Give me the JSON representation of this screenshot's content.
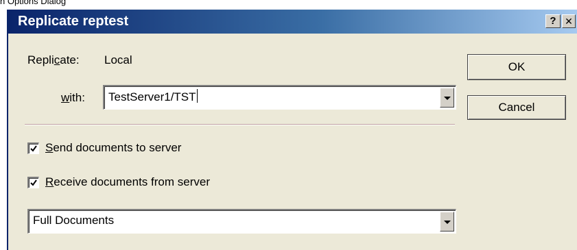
{
  "caption": "n Options Dialog",
  "dialog": {
    "title": "Replicate reptest",
    "help_button": "?",
    "close_button": "✕",
    "replicate_label_pre": "Repli",
    "replicate_label_hot": "c",
    "replicate_label_post": "ate:",
    "replicate_value": "Local",
    "with_label_hot": "w",
    "with_label_post": "ith:",
    "with_value": "TestServer1/TST",
    "ok_label": "OK",
    "cancel_label": "Cancel",
    "send_checked": true,
    "send_label_hot": "S",
    "send_label_post": "end documents to server",
    "receive_checked": true,
    "receive_label_hot": "R",
    "receive_label_post": "eceive documents from server",
    "receive_mode_value": "Full Documents"
  },
  "colors": {
    "titlebar_start": "#0a246a",
    "titlebar_end": "#a6caf0",
    "dialog_bg": "#ece9d8"
  }
}
